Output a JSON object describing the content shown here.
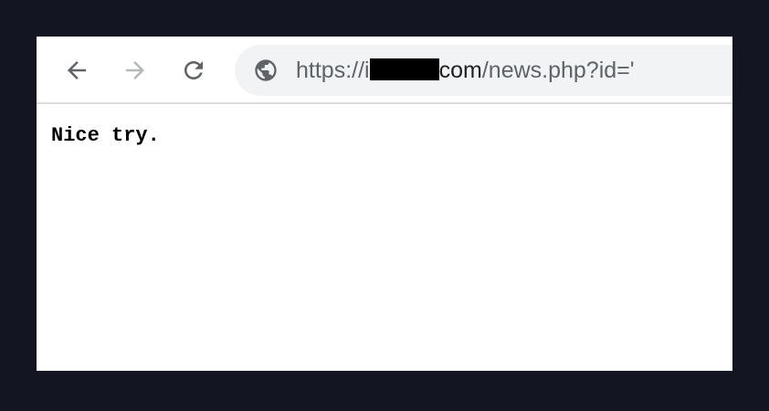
{
  "toolbar": {
    "back_icon": "arrow-left-icon",
    "forward_icon": "arrow-right-icon",
    "reload_icon": "reload-icon",
    "site_icon": "globe-icon"
  },
  "address_bar": {
    "scheme": "https://",
    "host_visible_prefix": "i",
    "host_redacted": true,
    "host_visible_suffix": "com",
    "path": "/news.php?id='"
  },
  "page": {
    "body_text": "Nice try."
  },
  "colors": {
    "backdrop": "#131522",
    "icon_active": "#5f6368",
    "icon_disabled": "#b4b7bb",
    "omnibox_bg": "#f1f3f4"
  }
}
